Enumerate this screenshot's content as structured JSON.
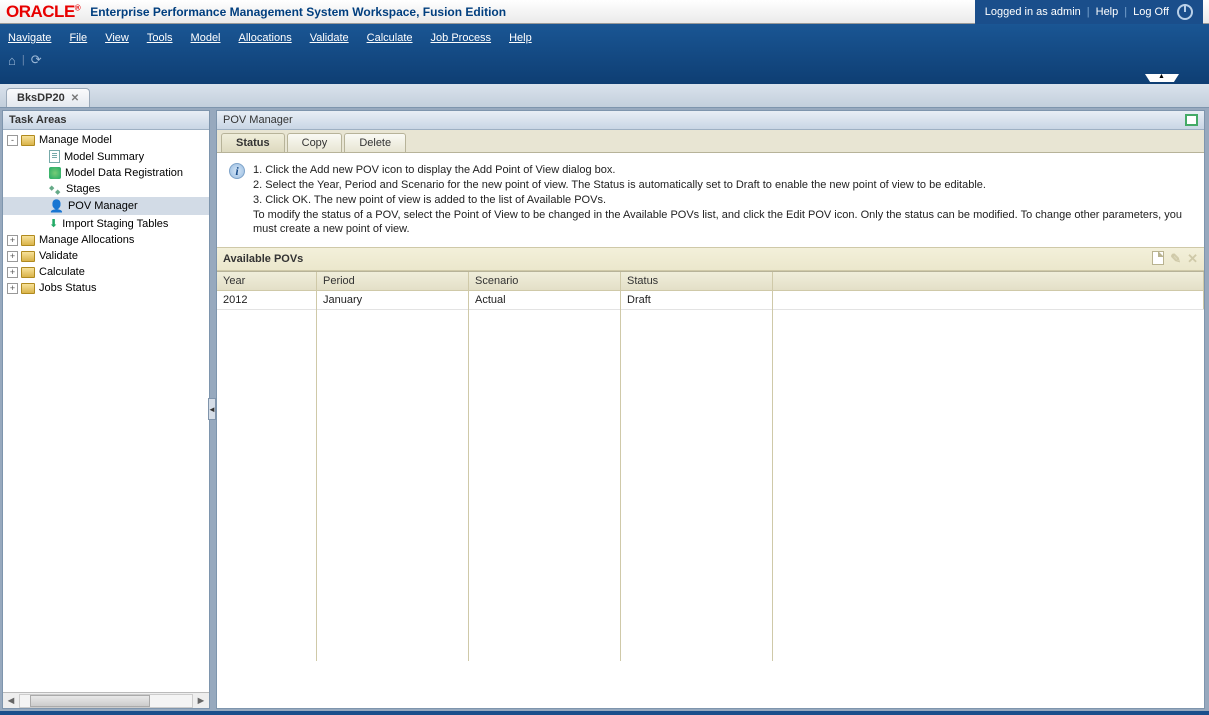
{
  "header": {
    "logo_text": "ORACLE",
    "logo_reg": "®",
    "title": "Enterprise Performance Management System Workspace, Fusion Edition",
    "logged_in": "Logged in as admin",
    "help": "Help",
    "logoff": "Log Off"
  },
  "menu": [
    "Navigate",
    "File",
    "View",
    "Tools",
    "Model",
    "Allocations",
    "Validate",
    "Calculate",
    "Job Process",
    "Help"
  ],
  "doc_tab": {
    "label": "BksDP20"
  },
  "sidebar": {
    "title": "Task Areas",
    "tree": [
      {
        "toggle": "-",
        "indent": 0,
        "icon": "folder",
        "label": "Manage Model"
      },
      {
        "toggle": "",
        "indent": 2,
        "icon": "page",
        "label": "Model Summary"
      },
      {
        "toggle": "",
        "indent": 2,
        "icon": "reg",
        "label": "Model Data Registration"
      },
      {
        "toggle": "",
        "indent": 2,
        "icon": "stages",
        "label": "Stages"
      },
      {
        "toggle": "",
        "indent": 2,
        "icon": "person",
        "label": "POV Manager",
        "selected": true
      },
      {
        "toggle": "",
        "indent": 2,
        "icon": "import",
        "label": "Import Staging Tables"
      },
      {
        "toggle": "+",
        "indent": 0,
        "icon": "folder",
        "label": "Manage Allocations"
      },
      {
        "toggle": "+",
        "indent": 0,
        "icon": "folder",
        "label": "Validate"
      },
      {
        "toggle": "+",
        "indent": 0,
        "icon": "folder",
        "label": "Calculate"
      },
      {
        "toggle": "+",
        "indent": 0,
        "icon": "folder",
        "label": "Jobs Status"
      }
    ]
  },
  "main": {
    "panel_title": "POV Manager",
    "tabs": [
      "Status",
      "Copy",
      "Delete"
    ],
    "active_tab": 0,
    "info_lines": [
      "1. Click the Add new POV icon to display the Add Point of View dialog box.",
      "2. Select the Year, Period and Scenario for the new point of view. The Status is automatically set to Draft to enable the new point of view to be editable.",
      "3. Click OK. The new point of view is added to the list of Available POVs.",
      "To modify the status of a POV, select the Point of View to be changed in the Available POVs list, and click the Edit POV icon. Only the status can be modified. To change other parameters, you must create a new point of view."
    ],
    "section_title": "Available POVs",
    "columns": [
      "Year",
      "Period",
      "Scenario",
      "Status",
      ""
    ],
    "rows": [
      {
        "year": "2012",
        "period": "January",
        "scenario": "Actual",
        "status": "Draft"
      }
    ]
  }
}
